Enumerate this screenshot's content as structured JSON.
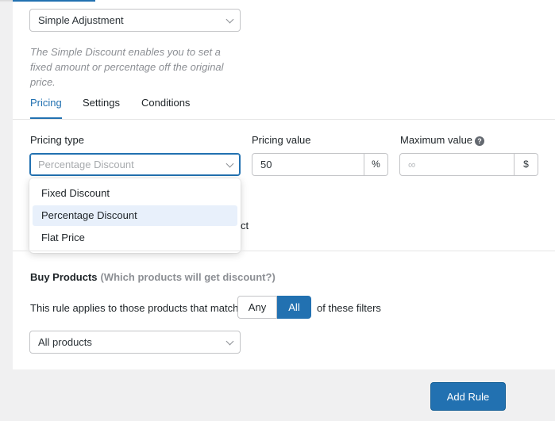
{
  "rule_type": {
    "selected": "Simple Adjustment"
  },
  "description": "The Simple Discount enables you to set a fixed amount or percentage off the original price.",
  "tabs": [
    {
      "label": "Pricing",
      "active": true
    },
    {
      "label": "Settings",
      "active": false
    },
    {
      "label": "Conditions",
      "active": false
    }
  ],
  "pricing": {
    "type_label": "Pricing type",
    "type_placeholder": "Percentage Discount",
    "value_label": "Pricing value",
    "value": "50",
    "value_unit": "%",
    "max_label": "Maximum value",
    "max_placeholder": "∞",
    "max_unit": "$",
    "help_icon": "?"
  },
  "dropdown": {
    "options": [
      "Fixed Discount",
      "Percentage Discount",
      "Flat Price"
    ],
    "selected": "Percentage Discount"
  },
  "partial_hidden_text": "ct",
  "buy_products": {
    "title": "Buy Products",
    "subtitle": "(Which products will get discount?)",
    "match_prefix": "This rule applies to those products that match",
    "match_any": "Any",
    "match_all": "All",
    "match_selected": "All",
    "match_suffix": "of these filters",
    "filter_selected": "All products"
  },
  "actions": {
    "add_rule": "Add Rule"
  },
  "colors": {
    "accent": "#2271b1",
    "page_bg": "#f0f0f1"
  }
}
